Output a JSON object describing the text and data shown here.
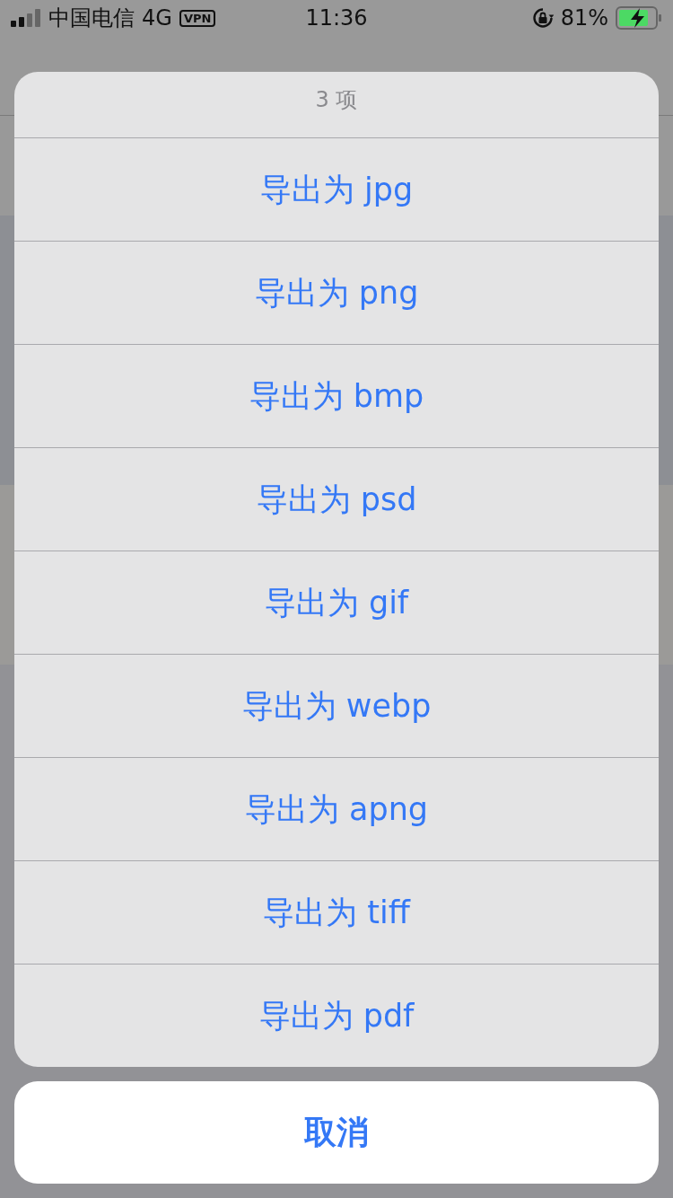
{
  "status_bar": {
    "carrier": "中国电信",
    "network": "4G",
    "vpn": "VPN",
    "time": "11:36",
    "battery": "81%"
  },
  "action_sheet": {
    "title": "3 项",
    "actions": [
      {
        "label": "导出为 jpg"
      },
      {
        "label": "导出为 png"
      },
      {
        "label": "导出为 bmp"
      },
      {
        "label": "导出为 psd"
      },
      {
        "label": "导出为 gif"
      },
      {
        "label": "导出为 webp"
      },
      {
        "label": "导出为 apng"
      },
      {
        "label": "导出为 tiff"
      },
      {
        "label": "导出为 pdf"
      }
    ],
    "cancel": "取消"
  }
}
